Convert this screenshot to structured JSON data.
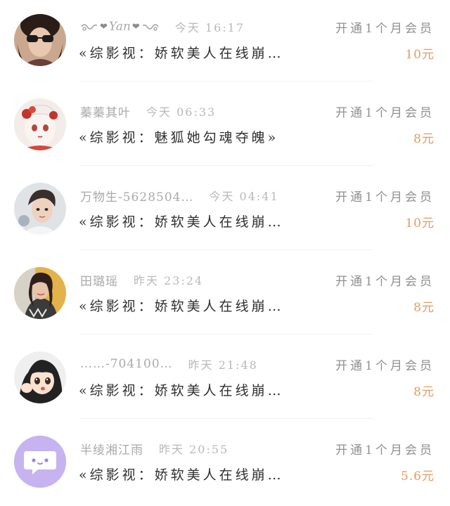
{
  "items": [
    {
      "username": "Yan",
      "time": "今天 16:17",
      "product": "开通1个月会员",
      "description": "«综影视：娇软美人在线崩…",
      "price": "10元"
    },
    {
      "username": "蓁蓁其叶",
      "time": "今天 06:33",
      "product": "开通1个月会员",
      "description": "«综影视：魅狐她勾魂夺魄»",
      "price": "8元"
    },
    {
      "username": "万物生-5628504…",
      "time": "今天 04:41",
      "product": "开通1个月会员",
      "description": "«综影视：娇软美人在线崩…",
      "price": "10元"
    },
    {
      "username": "田璐瑶",
      "time": "昨天 23:24",
      "product": "开通1个月会员",
      "description": "«综影视：娇软美人在线崩…",
      "price": "8元"
    },
    {
      "username": "……-704100…",
      "time": "昨天 21:48",
      "product": "开通1个月会员",
      "description": "«综影视：娇软美人在线崩…",
      "price": "8元"
    },
    {
      "username": "半绫湘江雨",
      "time": "昨天 20:55",
      "product": "开通1个月会员",
      "description": "«综影视：娇软美人在线崩…",
      "price": "5.6元"
    }
  ]
}
